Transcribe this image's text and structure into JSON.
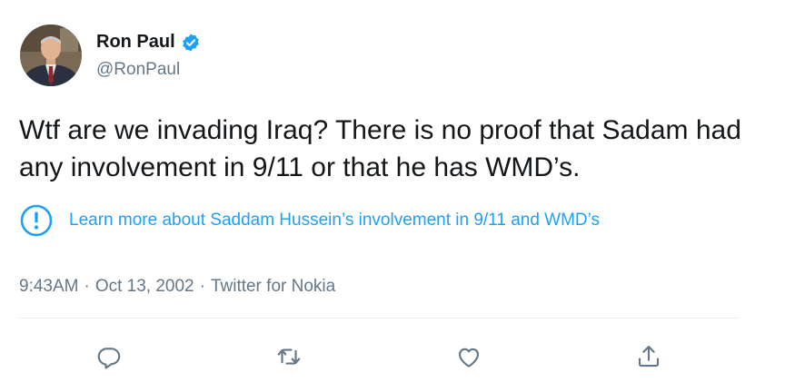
{
  "author": {
    "display_name": "Ron Paul",
    "handle": "@RonPaul",
    "verified_icon": "verified-badge-icon",
    "verified_color": "#1da1f2"
  },
  "tweet": {
    "text": "Wtf are we invading Iraq? There is no proof that Sadam had any involvement in 9/11 or that he has WMD’s."
  },
  "notice": {
    "icon": "exclamation-circle-icon",
    "text": "Learn more about Saddam Hussein’s involvement in 9/11 and WMD’s",
    "color": "#1da1f2"
  },
  "meta": {
    "time": "9:43AM",
    "separator": "·",
    "date": "Oct 13, 2002",
    "source": "Twitter for Nokia"
  },
  "actions": [
    {
      "icon": "reply-icon"
    },
    {
      "icon": "retweet-icon"
    },
    {
      "icon": "like-icon"
    },
    {
      "icon": "share-icon"
    }
  ],
  "colors": {
    "text_primary": "#14171a",
    "text_secondary": "#657786",
    "accent": "#1da1f2",
    "divider": "#e6ecf0"
  }
}
